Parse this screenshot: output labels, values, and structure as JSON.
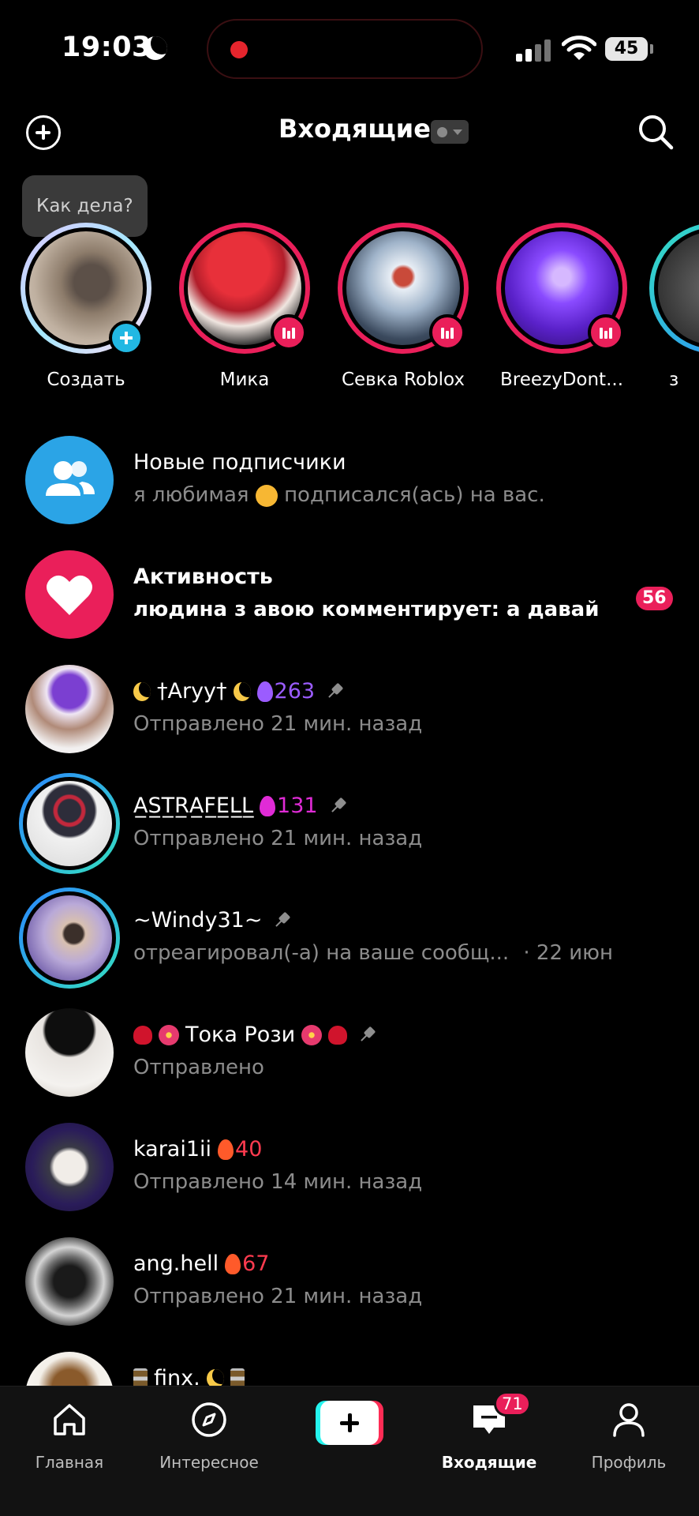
{
  "status_bar": {
    "time": "19:03",
    "battery": "45"
  },
  "header": {
    "title": "Входящие"
  },
  "stories": {
    "prompt_bubble": "Как дела?",
    "items": [
      {
        "name": "Создать",
        "ring": "none"
      },
      {
        "name": "Мика",
        "ring": "live"
      },
      {
        "name": "Севка Roblox",
        "ring": "live"
      },
      {
        "name": "BreezyDont...",
        "ring": "live"
      },
      {
        "name": "з",
        "ring": "gradient"
      }
    ]
  },
  "inbox": {
    "new_followers": {
      "title": "Новые подписчики",
      "subtitle_pre": "я любимая",
      "subtitle_post": "подписался(ась) на вас."
    },
    "activity": {
      "title": "Активность",
      "subtitle": "людина з авою комментирует: а давай",
      "count": "56"
    },
    "chats": [
      {
        "name": "†Aryy†",
        "streak": "263",
        "streak_color": "#9b5cff",
        "status": "Отправлено 21 мин. назад",
        "pinned": true
      },
      {
        "name": "A̲S̲T̲R̲A̲F̲E̲L̲L̲",
        "streak": "131",
        "streak_color": "#e02bd6",
        "status": "Отправлено 21 мин. назад",
        "pinned": true
      },
      {
        "name": "~Windy31~",
        "streak": "",
        "status": "отреагировал(-а) на ваше сообщ...",
        "date": "· 22 июн",
        "pinned": true
      },
      {
        "name": "Тока Рози",
        "streak": "",
        "status": "Отправлено",
        "pinned": true
      },
      {
        "name": "karai1ii",
        "streak": "40",
        "streak_color": "#ff3b4f",
        "status": "Отправлено 14 мин. назад",
        "pinned": false
      },
      {
        "name": "ang.hell",
        "streak": "67",
        "streak_color": "#ff3b4f",
        "status": "Отправлено 21 мин. назад",
        "pinned": false
      },
      {
        "name": "finx.",
        "streak": "",
        "status": "",
        "pinned": false
      }
    ]
  },
  "bottom_nav": {
    "home": "Главная",
    "discover": "Интересное",
    "inbox": "Входящие",
    "inbox_badge": "71",
    "profile": "Профиль"
  },
  "colors": {
    "accent": "#ea1f5a",
    "info_blue": "#2ba4e6",
    "tiktok_cyan": "#25f4ee",
    "tiktok_red": "#fe2c55"
  }
}
